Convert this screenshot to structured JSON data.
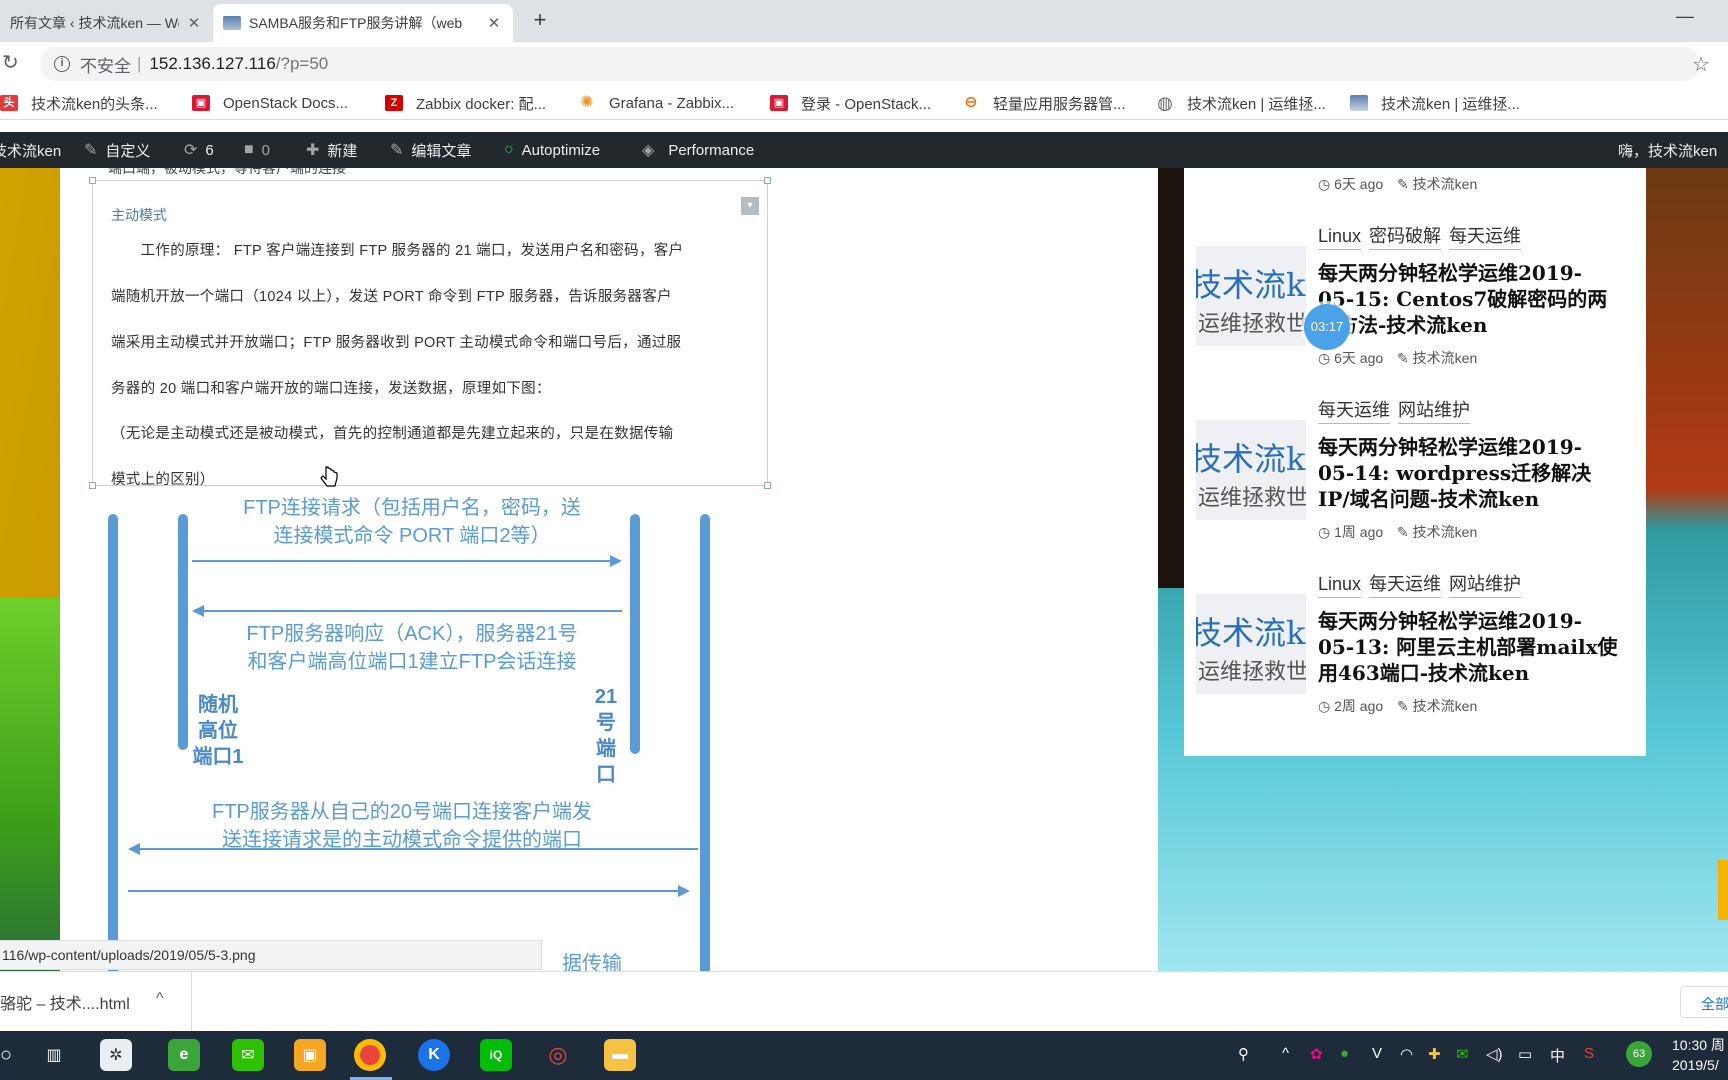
{
  "browser": {
    "tabs": [
      {
        "title": "所有文章 ‹ 技术流ken — WordPress",
        "close": "✕"
      },
      {
        "title": "SAMBA服务和FTP服务讲解（web",
        "close": "✕"
      }
    ],
    "new_tab": "+",
    "minimize": "—",
    "security_label": "不安全",
    "url_host": "152.136.127.116",
    "url_path": "/?p=50",
    "star": "☆",
    "reload": "↻",
    "info": "i"
  },
  "bookmarks": [
    {
      "label": "技术流ken的头条...",
      "icon": "toutiao-icon",
      "color": "#e4393c",
      "glyph": "头"
    },
    {
      "label": "OpenStack Docs...",
      "icon": "openstack-icon",
      "color": "#da1a32",
      "glyph": "▣"
    },
    {
      "label": "Zabbix docker: 配...",
      "icon": "zabbix-icon",
      "color": "#d40000",
      "glyph": "Z"
    },
    {
      "label": "Grafana - Zabbix...",
      "icon": "grafana-icon",
      "color": "#f7931e",
      "glyph": "✺"
    },
    {
      "label": "登录 - OpenStack...",
      "icon": "openstack-icon",
      "color": "#da1a32",
      "glyph": "▣"
    },
    {
      "label": "轻量应用服务器管...",
      "icon": "aliyun-icon",
      "color": "#ff6a00",
      "glyph": "⊖"
    },
    {
      "label": "技术流ken | 运维拯...",
      "icon": "globe-icon",
      "color": "#5f6368",
      "glyph": "◍"
    },
    {
      "label": "技术流ken | 运维拯...",
      "icon": "site-icon",
      "color": "#7b93b8",
      "glyph": ""
    }
  ],
  "adminbar": {
    "site": "技术流ken",
    "customize": "自定义",
    "updates": "6",
    "comments": "0",
    "new": "新建",
    "edit": "编辑文章",
    "autoptimize": "Autoptimize",
    "performance": "Performance",
    "howdy": "嗨，技术流ken"
  },
  "excerpt": {
    "top_text": "端口端，被动模式，等待客户端的连接",
    "title": "主动模式",
    "toggle": "▾",
    "lines": [
      "　　工作的原理： FTP 客户端连接到 FTP 服务器的 21 端口，发送用户名和密码，客户",
      "端随机开放一个端口（1024 以上），发送  PORT 命令到 FTP 服务器，告诉服务器客户",
      "端采用主动模式并开放端口；FTP 服务器收到 PORT 主动模式命令和端口号后，通过服",
      "务器的 20 端口和客户端开放的端口连接，发送数据，原理如下图：",
      "（无论是主动模式还是被动模式，首先的控制通道都是先建立起来的，只是在数据传输",
      "模式上的区别）"
    ]
  },
  "diagram": {
    "req_line1": "FTP连接请求（包括用户名，密码，送",
    "req_line2": "连接模式命令 PORT 端口2等）",
    "ack_line1": "FTP服务器响应（ACK），服务器21号",
    "ack_line2": "和客户端高位端口1建立FTP会话连接",
    "left_label_1": "随机",
    "left_label_2": "高位",
    "left_label_3": "端口1",
    "right_label_1": "21",
    "right_label_2": "号",
    "right_label_3": "端",
    "right_label_4": "口",
    "data_line1": "FTP服务器从自己的20号端口连接客户端发",
    "data_line2": "送连接请求是的主动模式命令提供的端口",
    "bottom_partial": "据传输"
  },
  "status_url": "116/wp-content/uploads/2019/05/5-3.png",
  "sidebar": {
    "top_meta": {
      "time": "6天 ago",
      "author": "技术流ken"
    },
    "posts": [
      {
        "cats": [
          "Linux",
          "密码破解",
          "每天运维"
        ],
        "title": "每天两分钟轻松学运维2019-05-15: Centos7破解密码的两种方法-技术流ken",
        "time": "6天 ago",
        "author": "技术流ken"
      },
      {
        "cats": [
          "每天运维",
          "网站维护"
        ],
        "title": "每天两分钟轻松学运维2019-05-14: wordpress迁移解决IP/域名问题-技术流ken",
        "time": "1周 ago",
        "author": "技术流ken"
      },
      {
        "cats": [
          "Linux",
          "每天运维",
          "网站维护"
        ],
        "title": "每天两分钟轻松学运维2019-05-13: 阿里云主机部署mailx使用463端口-技术流ken",
        "time": "2周 ago",
        "author": "技术流ken"
      }
    ],
    "thumb_text_1": "技术流ken",
    "thumb_text_2": "运维拯救世界",
    "timer": "03:17"
  },
  "downloads": {
    "file": "骆驼 – 技术....html",
    "chevron": "^",
    "show_all": "全部"
  },
  "taskbar": {
    "clock_time": "10:30 周",
    "clock_date": "2019/5/",
    "ime": "中",
    "battery_badge": "63"
  }
}
